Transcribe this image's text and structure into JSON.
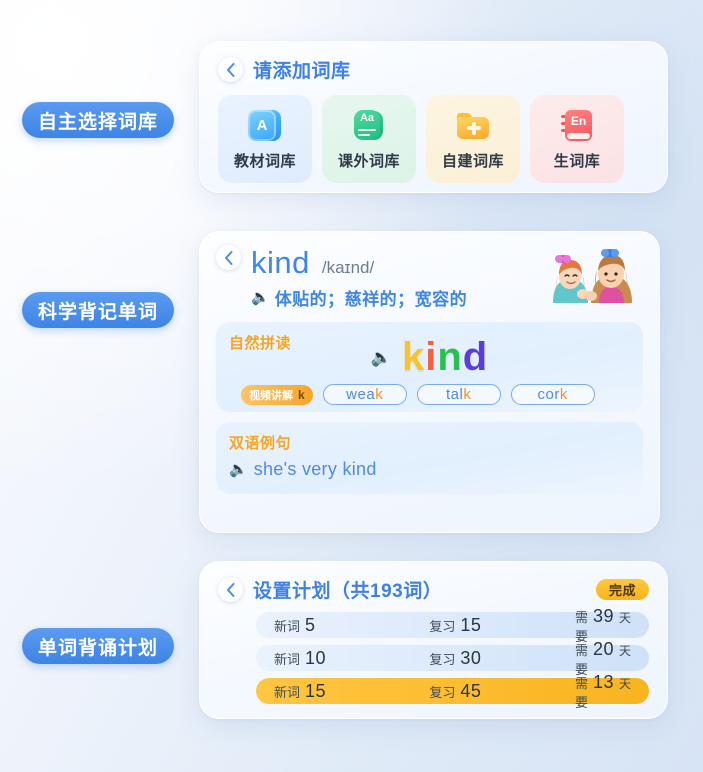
{
  "tags": [
    {
      "label": "自主选择词库"
    },
    {
      "label": "科学背记单词"
    },
    {
      "label": "单词背诵计划"
    }
  ],
  "library_card": {
    "title": "请添加词库",
    "back_icon": "chevron-left-icon",
    "items": [
      {
        "label": "教材词库",
        "icon": "book-a-icon",
        "glyph": "A"
      },
      {
        "label": "课外词库",
        "icon": "card-aa-icon",
        "glyph": "Aa"
      },
      {
        "label": "自建词库",
        "icon": "folder-plus-icon",
        "glyph": "+"
      },
      {
        "label": "生词库",
        "icon": "book-en-icon",
        "glyph": "En"
      }
    ]
  },
  "word_card": {
    "back_icon": "chevron-left-icon",
    "term": "kind",
    "phonetic": "/kaɪnd/",
    "speaker_icon": "speaker-icon",
    "meaning": "体贴的；慈祥的；宽容的",
    "illustration": "two-girls-illustration",
    "phonics": {
      "title": "自然拼读",
      "speaker_icon": "speaker-icon",
      "letters": [
        {
          "char": "k",
          "color": "#f7c52b"
        },
        {
          "char": "i",
          "color": "#f2613e"
        },
        {
          "char": "n",
          "color": "#27c24c"
        },
        {
          "char": "d",
          "color": "#5b3ddb"
        }
      ],
      "video_badge": {
        "label": "视频讲解",
        "letter": "k"
      },
      "chips": [
        {
          "text": "wea",
          "highlight": "k"
        },
        {
          "text": "tal",
          "highlight": "k"
        },
        {
          "text": "cor",
          "highlight": "k"
        }
      ]
    },
    "example": {
      "title": "双语例句",
      "speaker_icon": "speaker-icon",
      "sentence": "she's very kind"
    }
  },
  "plan_card": {
    "back_icon": "chevron-left-icon",
    "title": "设置计划（共193词）",
    "total_words": 193,
    "done_label": "完成",
    "columns": [
      "新词",
      "复习",
      "需要"
    ],
    "unit": "天",
    "rows": [
      {
        "new_label": "新词",
        "new_count": "5",
        "review_label": "复习",
        "review_count": "15",
        "need_label": "需要",
        "days": "39",
        "unit": "天",
        "active": false
      },
      {
        "new_label": "新词",
        "new_count": "10",
        "review_label": "复习",
        "review_count": "30",
        "need_label": "需要",
        "days": "20",
        "unit": "天",
        "active": false
      },
      {
        "new_label": "新词",
        "new_count": "15",
        "review_label": "复习",
        "review_count": "45",
        "need_label": "需要",
        "days": "13",
        "unit": "天",
        "active": true
      }
    ]
  },
  "colors": {
    "accent_blue": "#3f80e4",
    "accent_orange": "#f5a623",
    "highlight_amber": "#f9b41f",
    "tag_blue": "#4a8ceb"
  }
}
